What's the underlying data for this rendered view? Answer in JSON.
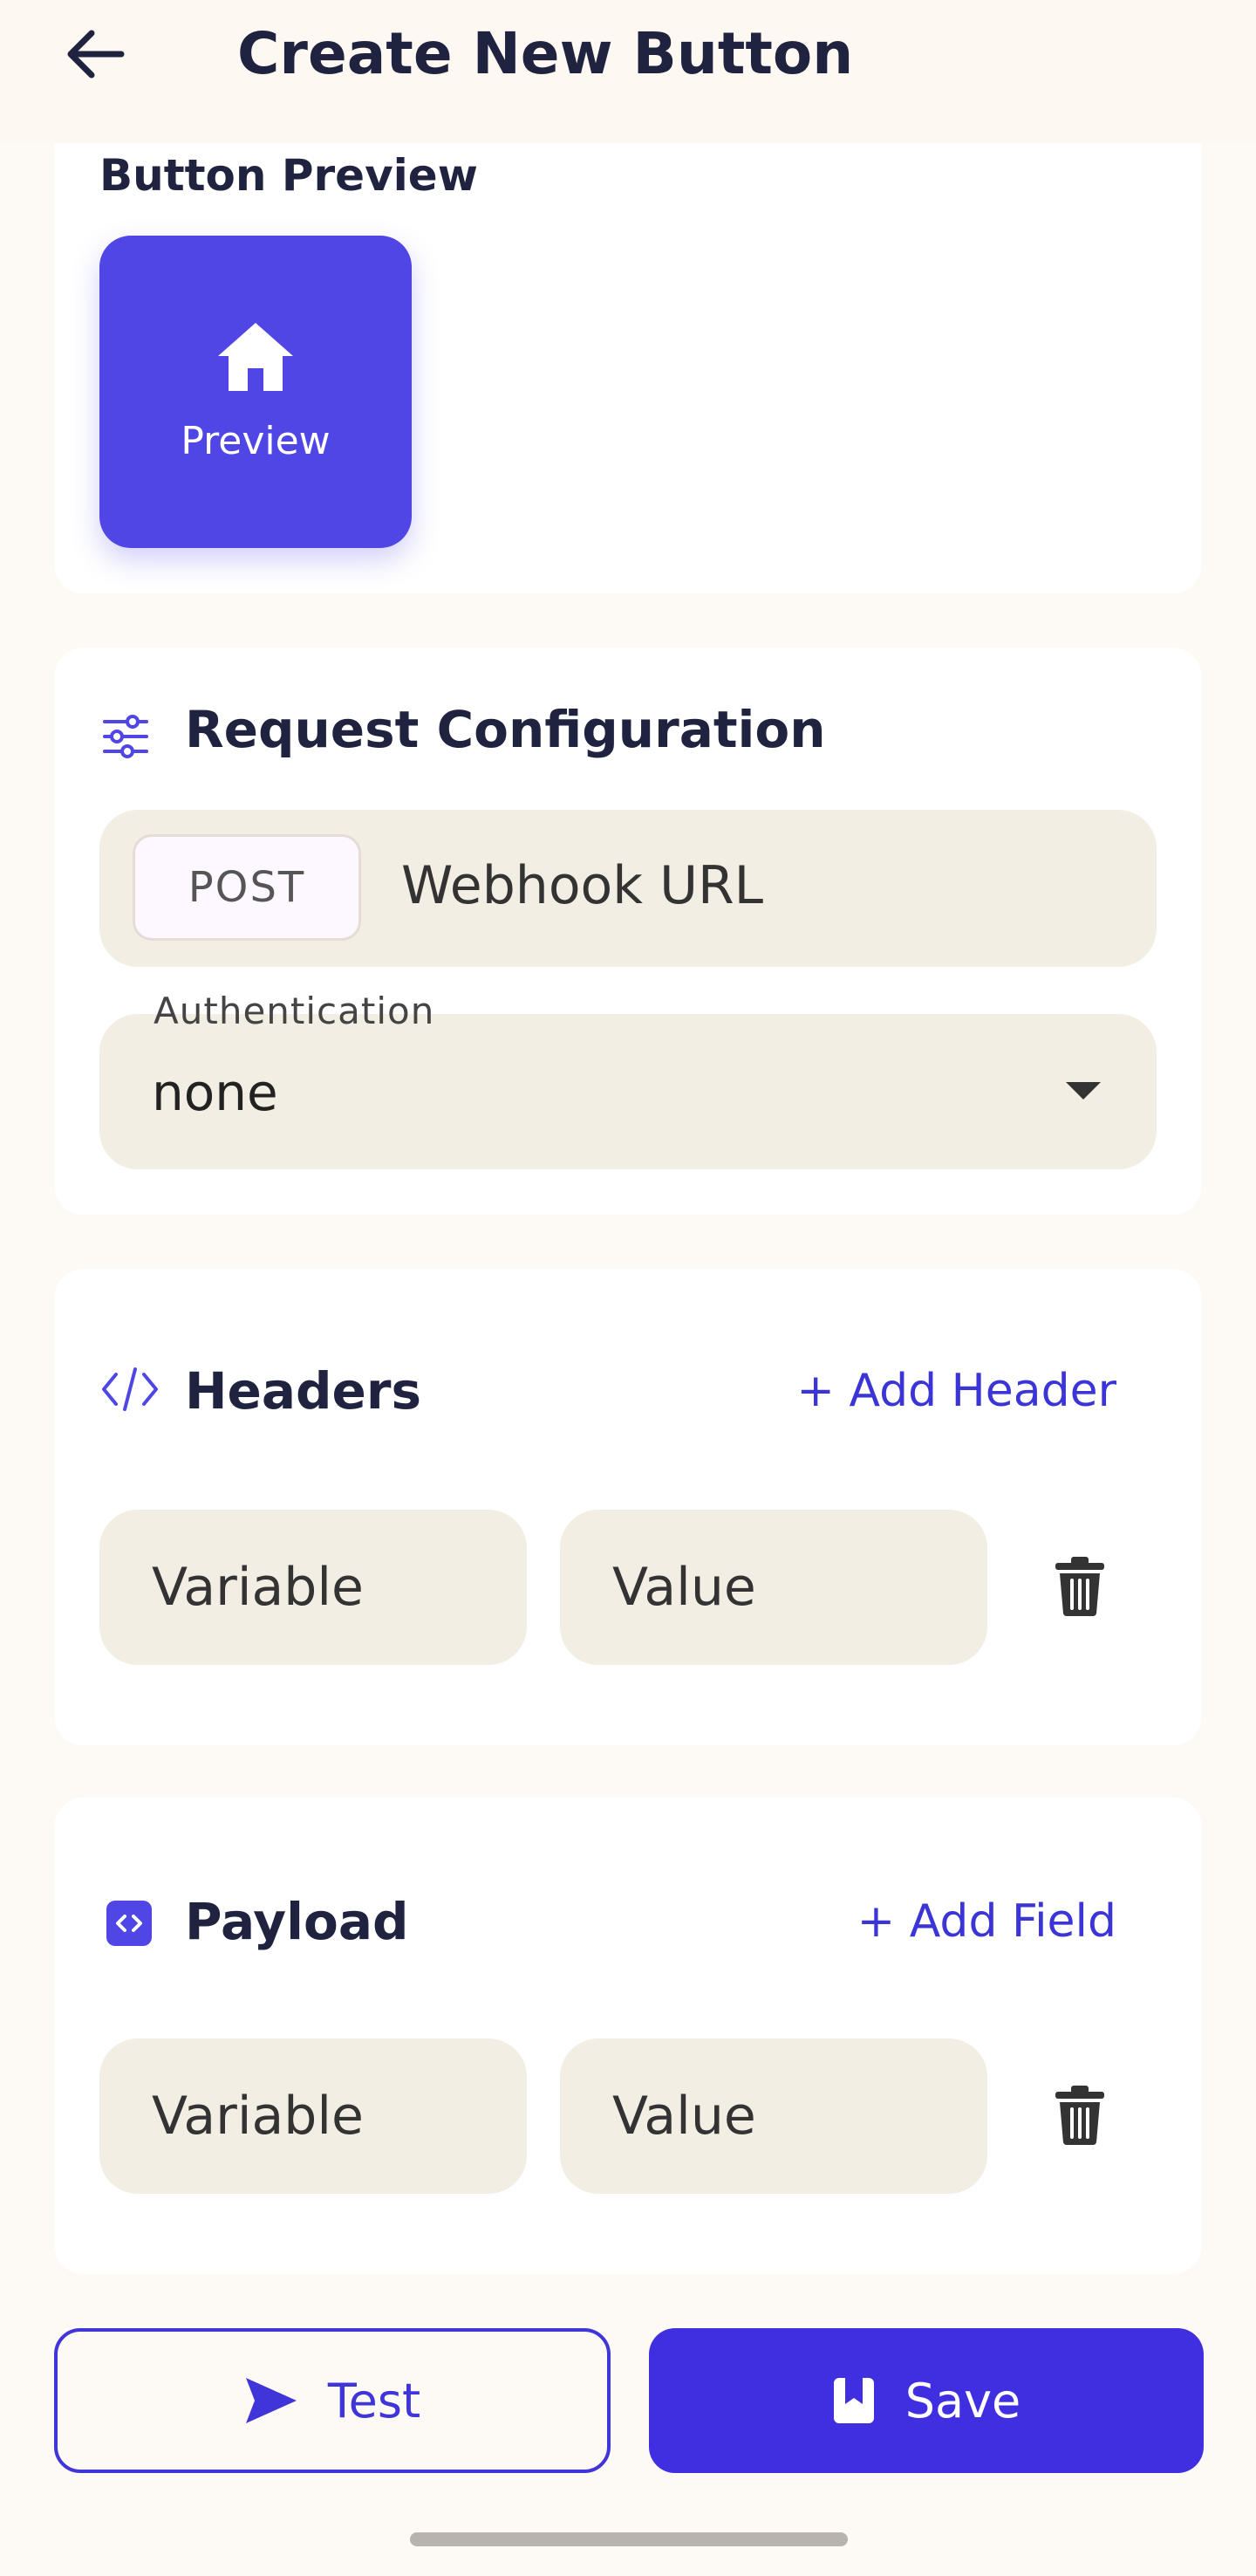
{
  "header": {
    "title": "Create New Button",
    "back_icon": "arrow-left-icon"
  },
  "preview": {
    "label": "Button Preview",
    "button_text": "Preview",
    "icon": "home-icon",
    "color": "#4f46e5"
  },
  "request": {
    "title": "Request Configuration",
    "icon": "sliders-icon",
    "method": "POST",
    "url_placeholder": "Webhook URL",
    "auth_label": "Authentication",
    "auth_value": "none"
  },
  "headers": {
    "title": "Headers",
    "icon": "code-icon",
    "add_label": "+ Add Header",
    "rows": [
      {
        "variable_placeholder": "Variable",
        "value_placeholder": "Value"
      }
    ]
  },
  "payload": {
    "title": "Payload",
    "icon": "code-box-icon",
    "add_label": "+ Add Field",
    "rows": [
      {
        "variable_placeholder": "Variable",
        "value_placeholder": "Value"
      }
    ]
  },
  "actions": {
    "test_label": "Test",
    "save_label": "Save",
    "accent": "#3f2fe0"
  }
}
